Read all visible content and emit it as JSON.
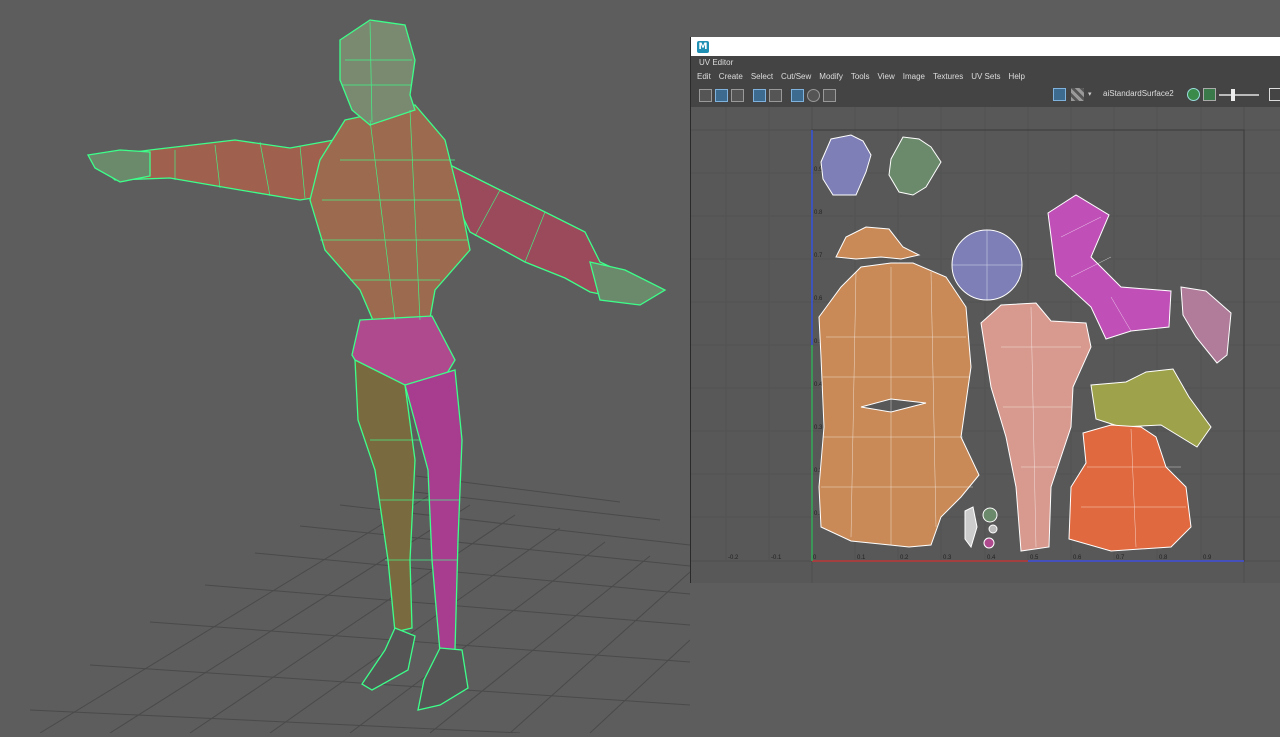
{
  "uv_editor": {
    "panel_title": "UV Editor",
    "menus": [
      "Edit",
      "Create",
      "Select",
      "Cut/Sew",
      "Modify",
      "Tools",
      "View",
      "Image",
      "Textures",
      "UV Sets",
      "Help"
    ],
    "shader_name": "aiStandardSurface2",
    "axis_x_labels": [
      "-0.2",
      "-0.1",
      "0",
      "0.1",
      "0.2",
      "0.3",
      "0.4",
      "0.5",
      "0.6",
      "0.7",
      "0.8",
      "0.9"
    ],
    "axis_y_labels": [
      "0.9",
      "0.8",
      "0.7",
      "0.6",
      "0.5",
      "0.4",
      "0.3",
      "0.2",
      "0.1"
    ]
  },
  "icons": {
    "app": "maya-app-icon",
    "toolbar_left": [
      "grid-icon",
      "uv-shell-icon",
      "texture-icon",
      "frame-icon",
      "filter-icon",
      "checker-icon",
      "snap-icon",
      "camera-icon"
    ],
    "toolbar_right": [
      "shaded-uv-icon",
      "checker-pattern-icon",
      "dropdown-arrow-icon",
      "globe-icon",
      "image-icon",
      "slider-icon",
      "expand-icon"
    ]
  },
  "colors": {
    "wireframe": "#3dff8a",
    "viewport_bg": "#5d5d5d",
    "uv_shells": [
      "#c98a57",
      "#d89a8f",
      "#c04fb8",
      "#e0693f",
      "#9ea24a",
      "#7e7fb6",
      "#b07c9a"
    ]
  }
}
